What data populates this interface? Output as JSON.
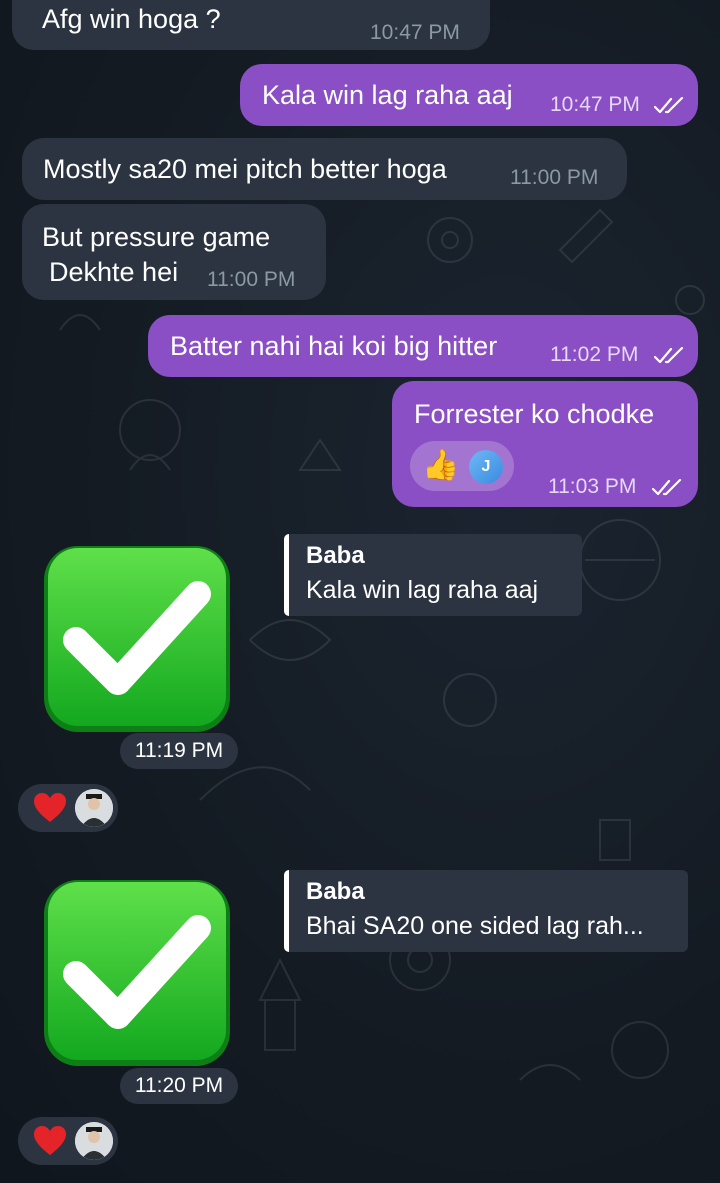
{
  "messages": [
    {
      "text": "Afg win hoga ?",
      "time": "10:47 PM",
      "direction": "incoming"
    },
    {
      "text": "Kala win lag raha aaj",
      "time": "10:47 PM",
      "direction": "outgoing",
      "read": true
    },
    {
      "text": "Mostly sa20 mei pitch better hoga",
      "time": "11:00 PM",
      "direction": "incoming"
    },
    {
      "text_line1": "But pressure game",
      "text_line2": "Dekhte hei",
      "time": "11:00 PM",
      "direction": "incoming"
    },
    {
      "text": "Batter nahi hai koi big hitter",
      "time": "11:02 PM",
      "direction": "outgoing",
      "read": true
    },
    {
      "text": "Forrester ko chodke",
      "time": "11:03 PM",
      "direction": "outgoing",
      "read": true,
      "reaction_emoji": "thumbs-up",
      "reaction_user_initial": "J"
    }
  ],
  "stickers": [
    {
      "sticker": "check-mark-button",
      "time": "11:19 PM",
      "reply_name": "Baba",
      "reply_text": "Kala win lag raha aaj",
      "reaction": "red-heart"
    },
    {
      "sticker": "check-mark-button",
      "time": "11:20 PM",
      "reply_name": "Baba",
      "reply_text": "Bhai SA20 one sided lag rah...",
      "reaction": "red-heart"
    }
  ],
  "colors": {
    "background": "#141b23",
    "incoming_bubble": "#2b3440",
    "outgoing_bubble": "#8a4fc4",
    "check_green": "#1fbf2a"
  }
}
